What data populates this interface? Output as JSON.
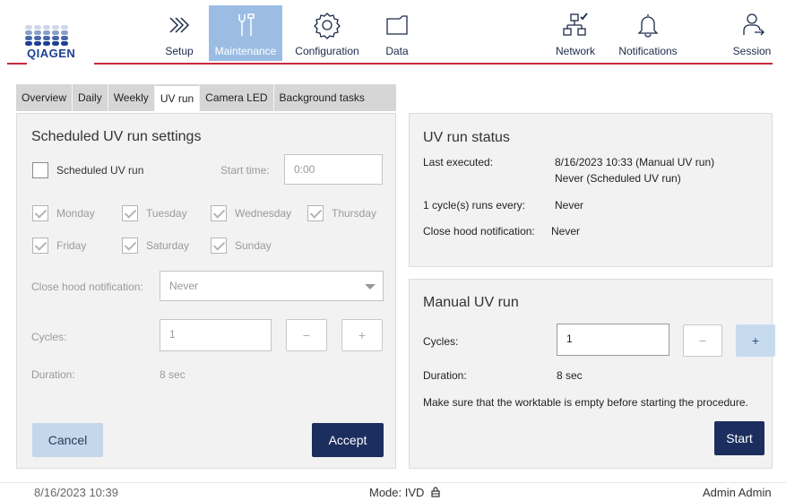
{
  "brand": {
    "logo_text": "QIAGEN",
    "accent_color": "#c8283e",
    "nav_active_color": "#9bbde3",
    "primary_button_color": "#1c2e5e"
  },
  "nav": {
    "setup": {
      "label": "Setup",
      "icon": "double-chevron-right-icon"
    },
    "maintenance": {
      "label": "Maintenance",
      "icon": "tools-icon",
      "active": true
    },
    "configuration": {
      "label": "Configuration",
      "icon": "gear-icon"
    },
    "data": {
      "label": "Data",
      "icon": "folder-icon"
    },
    "network": {
      "label": "Network",
      "icon": "network-connected-icon"
    },
    "notifications": {
      "label": "Notifications",
      "icon": "bell-icon"
    },
    "session": {
      "label": "Session",
      "icon": "user-logout-icon"
    }
  },
  "tabs": [
    {
      "label": "Overview"
    },
    {
      "label": "Daily"
    },
    {
      "label": "Weekly"
    },
    {
      "label": "UV run",
      "active": true
    },
    {
      "label": "Camera LED"
    },
    {
      "label": "Background tasks"
    }
  ],
  "scheduled": {
    "title": "Scheduled UV run settings",
    "checkbox_label": "Scheduled UV run",
    "start_time_label": "Start time:",
    "start_time_value": "0:00",
    "days": {
      "monday": "Monday",
      "tuesday": "Tuesday",
      "wednesday": "Wednesday",
      "thursday": "Thursday",
      "friday": "Friday",
      "saturday": "Saturday",
      "sunday": "Sunday"
    },
    "close_hood_label": "Close hood notification:",
    "close_hood_value": "Never",
    "cycles_label": "Cycles:",
    "cycles_value": "1",
    "minus": "−",
    "plus": "+",
    "duration_label": "Duration:",
    "duration_value": "8 sec",
    "cancel_label": "Cancel",
    "accept_label": "Accept"
  },
  "status": {
    "title": "UV run status",
    "last_executed_label": "Last executed:",
    "last_executed_line1": "8/16/2023 10:33 (Manual UV run)",
    "last_executed_line2": "Never (Scheduled UV run)",
    "cycles_every_label": "1 cycle(s) runs every:",
    "cycles_every_value": "Never",
    "close_hood_label": "Close hood notification:",
    "close_hood_value": "Never"
  },
  "manual": {
    "title": "Manual UV run",
    "cycles_label": "Cycles:",
    "cycles_value": "1",
    "minus": "−",
    "plus": "+",
    "duration_label": "Duration:",
    "duration_value": "8 sec",
    "notice": "Make sure that the worktable is empty before starting the procedure.",
    "start_label": "Start"
  },
  "footer": {
    "datetime": "8/16/2023 10:39",
    "mode": "Mode: IVD",
    "user": "Admin Admin"
  }
}
